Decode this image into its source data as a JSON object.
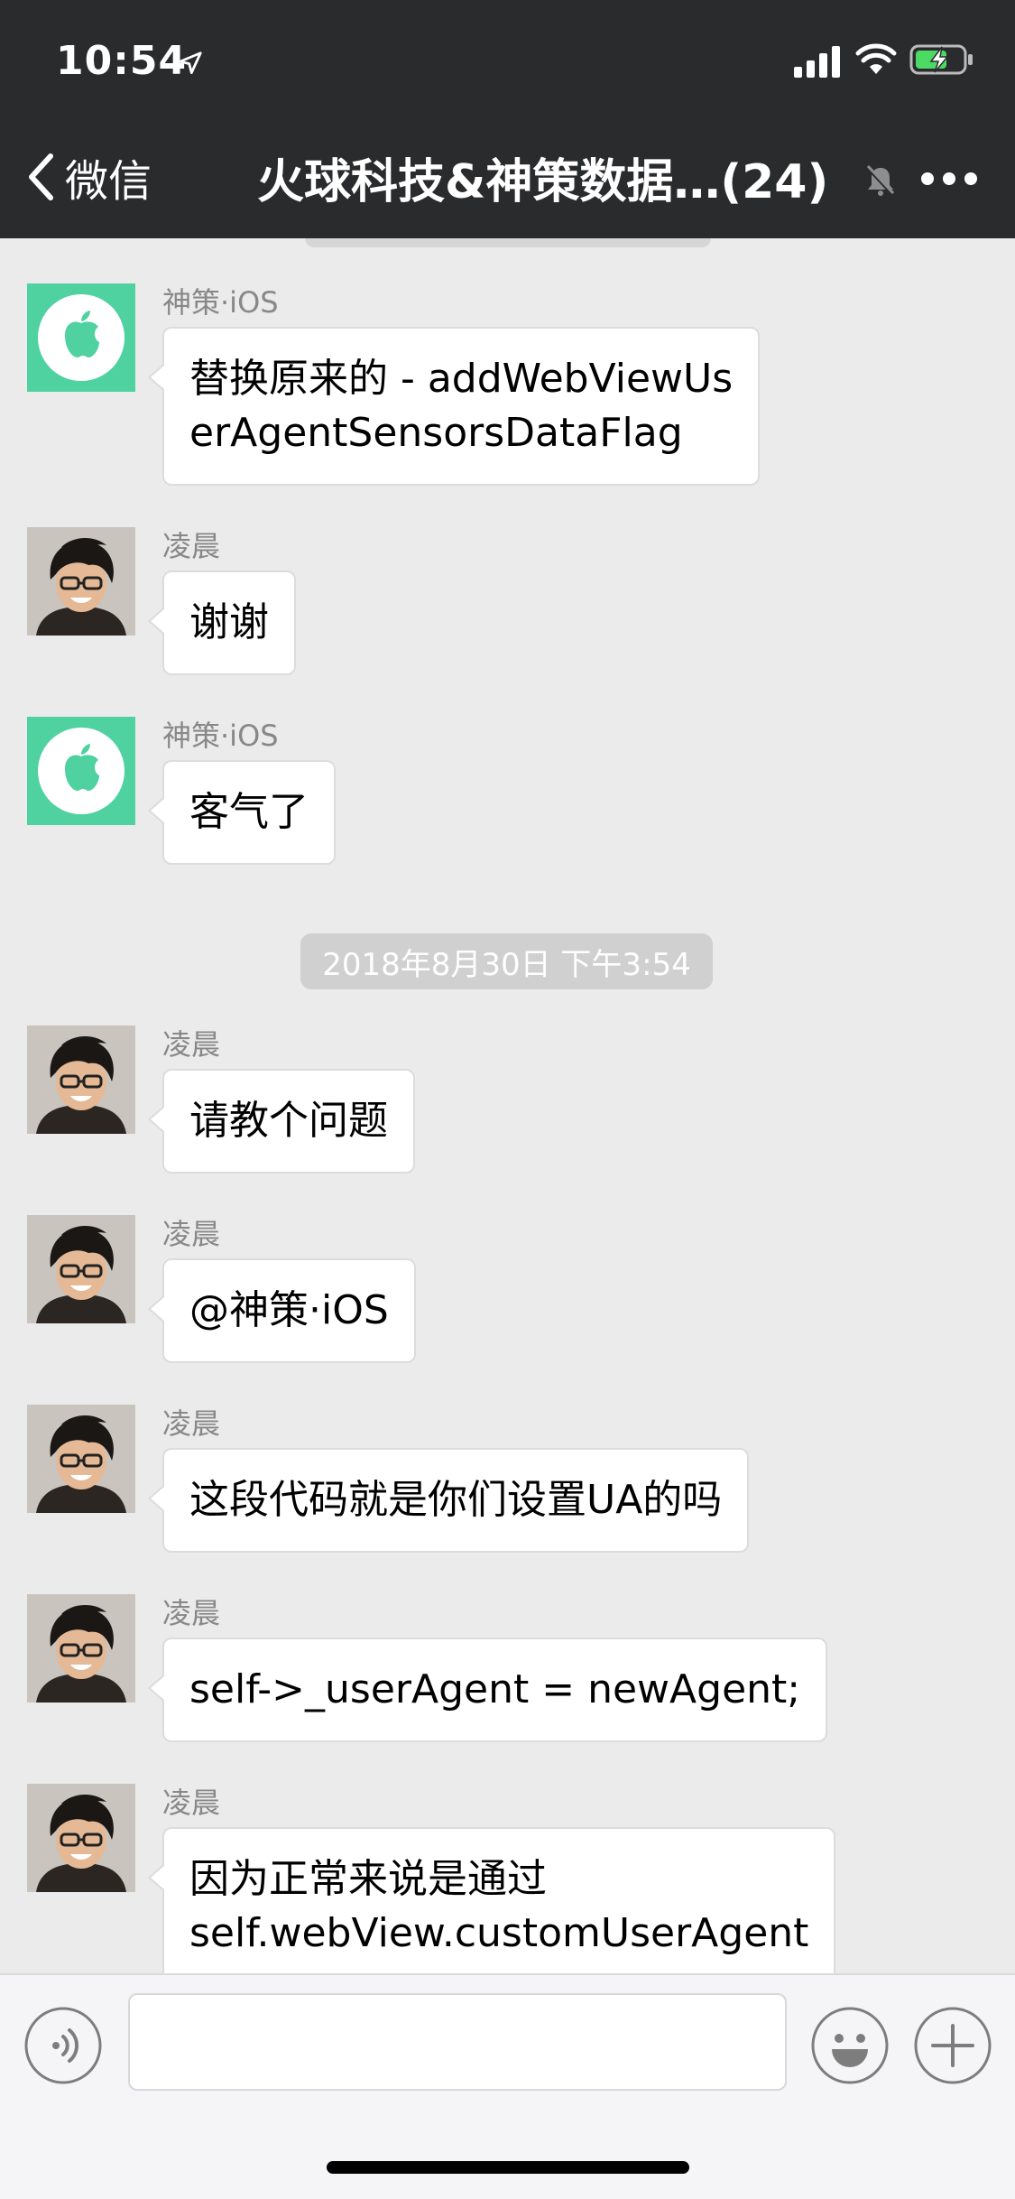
{
  "status_bar": {
    "time": "10:54"
  },
  "nav": {
    "back_label": "微信",
    "title": "火球科技&神策数据…(24)"
  },
  "chat": {
    "timestamp": "2018年8月30日 下午3:54",
    "messages": [
      {
        "sender": "神策·iOS",
        "avatar": "apple-logo-avatar",
        "lines": [
          "替换原来的 - addWebViewUs",
          "erAgentSensorsDataFlag"
        ]
      },
      {
        "sender": "凌晨",
        "avatar": "user-photo-avatar",
        "lines": [
          "谢谢"
        ]
      },
      {
        "sender": "神策·iOS",
        "avatar": "apple-logo-avatar",
        "lines": [
          "客气了"
        ]
      },
      {
        "sender": "凌晨",
        "avatar": "user-photo-avatar",
        "lines": [
          "请教个问题"
        ]
      },
      {
        "sender": "凌晨",
        "avatar": "user-photo-avatar",
        "lines": [
          "@神策·iOS"
        ]
      },
      {
        "sender": "凌晨",
        "avatar": "user-photo-avatar",
        "lines": [
          "这段代码就是你们设置UA的吗"
        ]
      },
      {
        "sender": "凌晨",
        "avatar": "user-photo-avatar",
        "lines": [
          "self->_userAgent = newAgent;"
        ]
      },
      {
        "sender": "凌晨",
        "avatar": "user-photo-avatar",
        "lines": [
          "因为正常来说是通过",
          "self.webView.customUserAgent"
        ]
      }
    ]
  },
  "input": {
    "placeholder": "",
    "value": ""
  },
  "colors": {
    "topbar_bg": "#2a2b2d",
    "chat_bg": "#ebebeb",
    "bubble_bg": "#ffffff",
    "sender_text": "#888888",
    "battery_green": "#4cd964",
    "apple_avatar_bg": "#4fd1a0"
  }
}
